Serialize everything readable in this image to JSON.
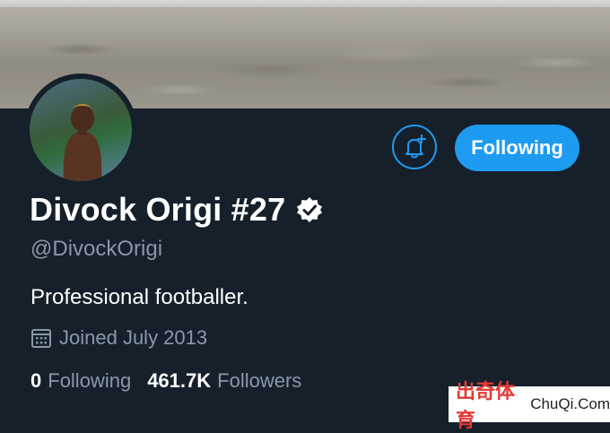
{
  "profile": {
    "name": "Divock Origi #27",
    "handle": "@DivockOrigi",
    "bio": "Professional footballer.",
    "joined": "Joined July 2013",
    "verified": true,
    "verified_icon": "verified-badge-icon"
  },
  "actions": {
    "notify_icon": "bell-plus-icon",
    "follow_label": "Following"
  },
  "stats": {
    "following_count": "0",
    "following_label": "Following",
    "followers_count": "461.7K",
    "followers_label": "Followers"
  },
  "watermark": {
    "cn": "出奇体育",
    "en": "ChuQi.Com"
  },
  "colors": {
    "background": "#15202b",
    "accent": "#1d9bf0",
    "secondary_text": "#8899a6"
  }
}
